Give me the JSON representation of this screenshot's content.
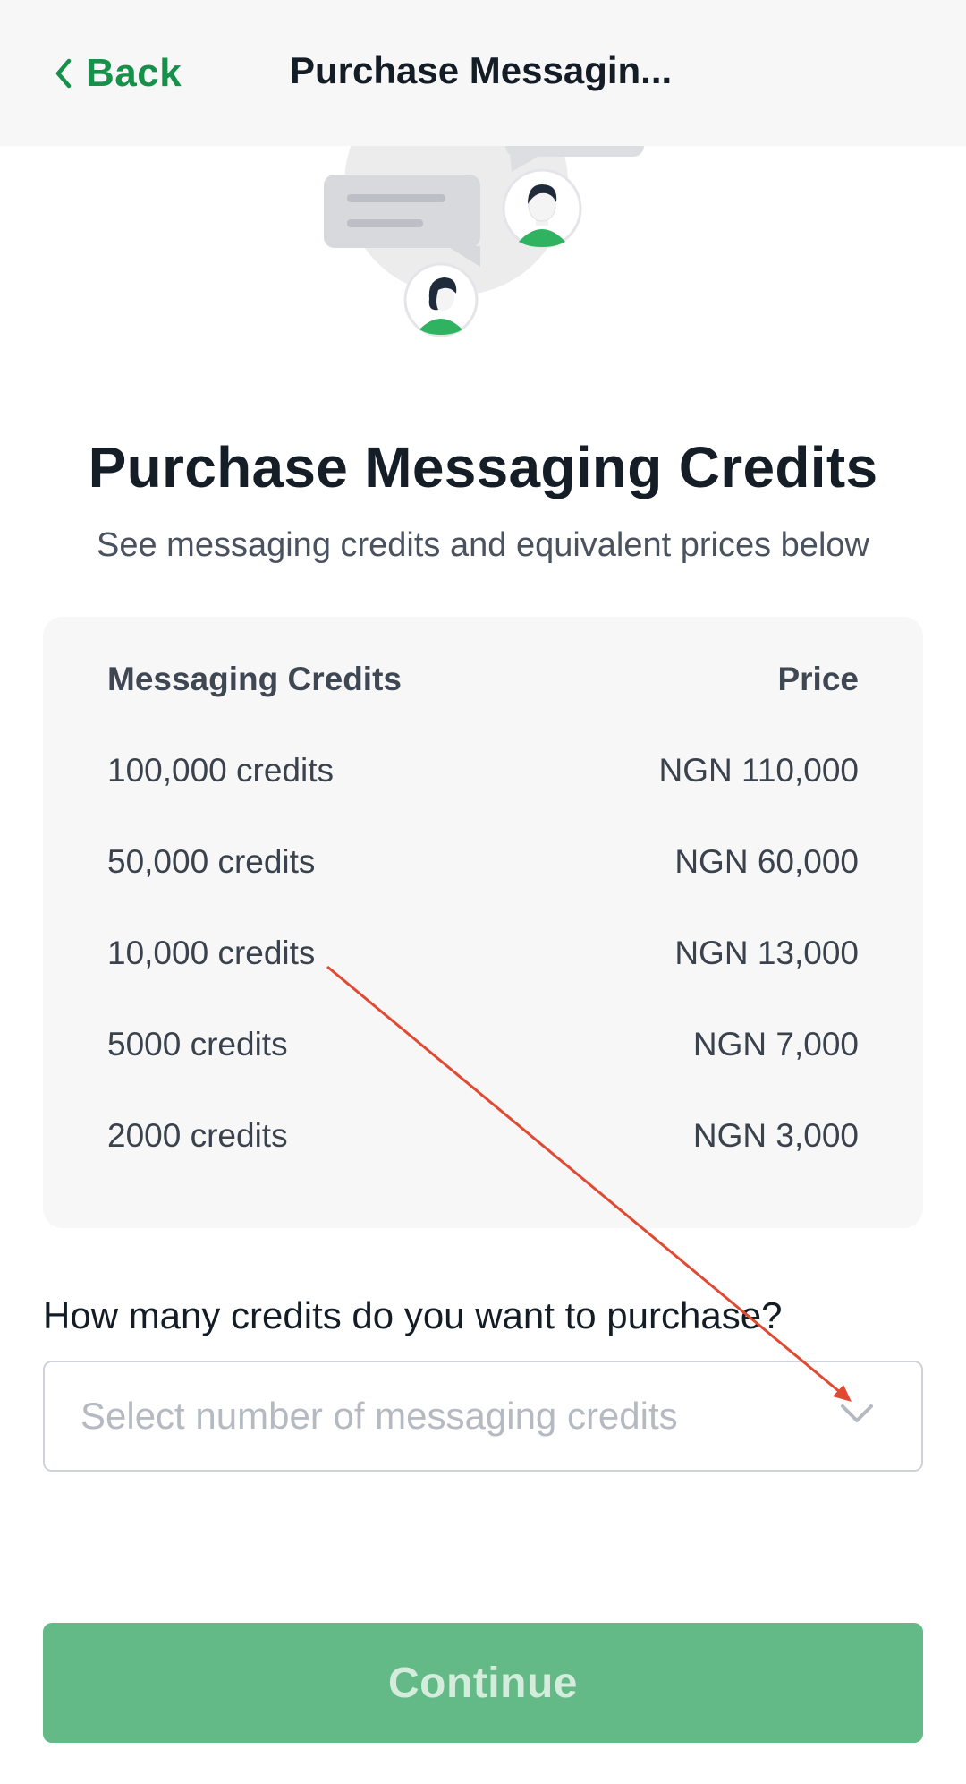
{
  "nav": {
    "back_label": "Back",
    "title": "Purchase Messagin..."
  },
  "header": {
    "title": "Purchase Messaging Credits",
    "subtitle": "See messaging credits and equivalent prices below"
  },
  "price_table": {
    "columns": [
      "Messaging Credits",
      "Price"
    ],
    "rows": [
      {
        "credits": "100,000 credits",
        "price": "NGN 110,000"
      },
      {
        "credits": "50,000 credits",
        "price": "NGN 60,000"
      },
      {
        "credits": "10,000 credits",
        "price": "NGN 13,000"
      },
      {
        "credits": "5000 credits",
        "price": "NGN 7,000"
      },
      {
        "credits": "2000 credits",
        "price": "NGN 3,000"
      }
    ]
  },
  "form": {
    "question": "How many credits do you want to purchase?",
    "select_placeholder": "Select number of messaging credits"
  },
  "actions": {
    "continue_label": "Continue"
  },
  "colors": {
    "brand_green": "#15914a",
    "button_green": "#63ba87",
    "annotation_red": "#e04a33"
  },
  "icons": [
    "chevron-left-icon",
    "chevron-down-icon",
    "chat-illustration"
  ]
}
